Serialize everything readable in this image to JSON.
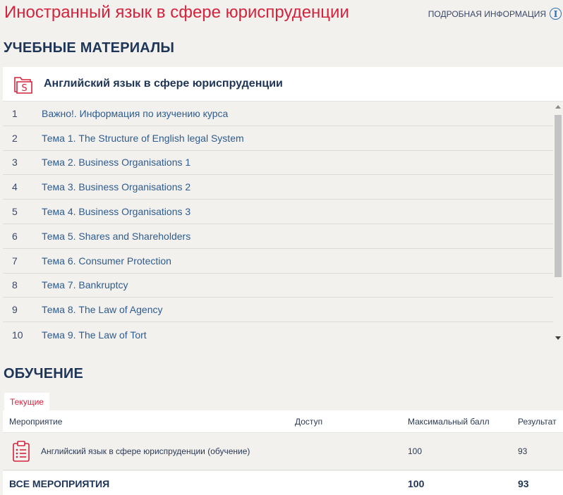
{
  "header": {
    "title": "Иностранный язык в сфере юриспруденции",
    "more_info": "ПОДРОБНАЯ ИНФОРМАЦИЯ",
    "info_glyph": "i"
  },
  "materials": {
    "heading": "УЧЕБНЫЕ МАТЕРИАЛЫ",
    "course_name": "Английский язык в сфере юриспруденции",
    "folder_glyph": "S",
    "items": [
      {
        "num": "1",
        "label": "Важно!. Информация по изучению курса"
      },
      {
        "num": "2",
        "label": "Тема 1. The Structure of English legal System"
      },
      {
        "num": "3",
        "label": "Тема 2. Business Organisations 1"
      },
      {
        "num": "4",
        "label": "Тема 3. Business Organisations 2"
      },
      {
        "num": "5",
        "label": "Тема 4. Business Organisations 3"
      },
      {
        "num": "6",
        "label": "Тема 5. Shares and Shareholders"
      },
      {
        "num": "7",
        "label": "Тема 6. Consumer Protection"
      },
      {
        "num": "8",
        "label": "Тема 7. Bankruptcy"
      },
      {
        "num": "9",
        "label": "Тема 8. The Law of Agency"
      },
      {
        "num": "10",
        "label": "Тема 9. The Law of Tort"
      }
    ]
  },
  "learning": {
    "heading": "ОБУЧЕНИЕ",
    "tab_current": "Текущие",
    "columns": {
      "event": "Мероприятие",
      "access": "Доступ",
      "max_score": "Максимальный балл",
      "result": "Результат"
    },
    "rows": [
      {
        "event": "Английский язык в сфере юриспруденции (обучение)",
        "access": "",
        "max_score": "100",
        "result": "93"
      }
    ],
    "total": {
      "label": "ВСЕ МЕРОПРИЯТИЯ",
      "max_score": "100",
      "result": "93"
    }
  },
  "colors": {
    "accent_red": "#d4243d",
    "navy": "#1f3557",
    "link_blue": "#2f5c8f",
    "background": "#f2f1ee"
  }
}
